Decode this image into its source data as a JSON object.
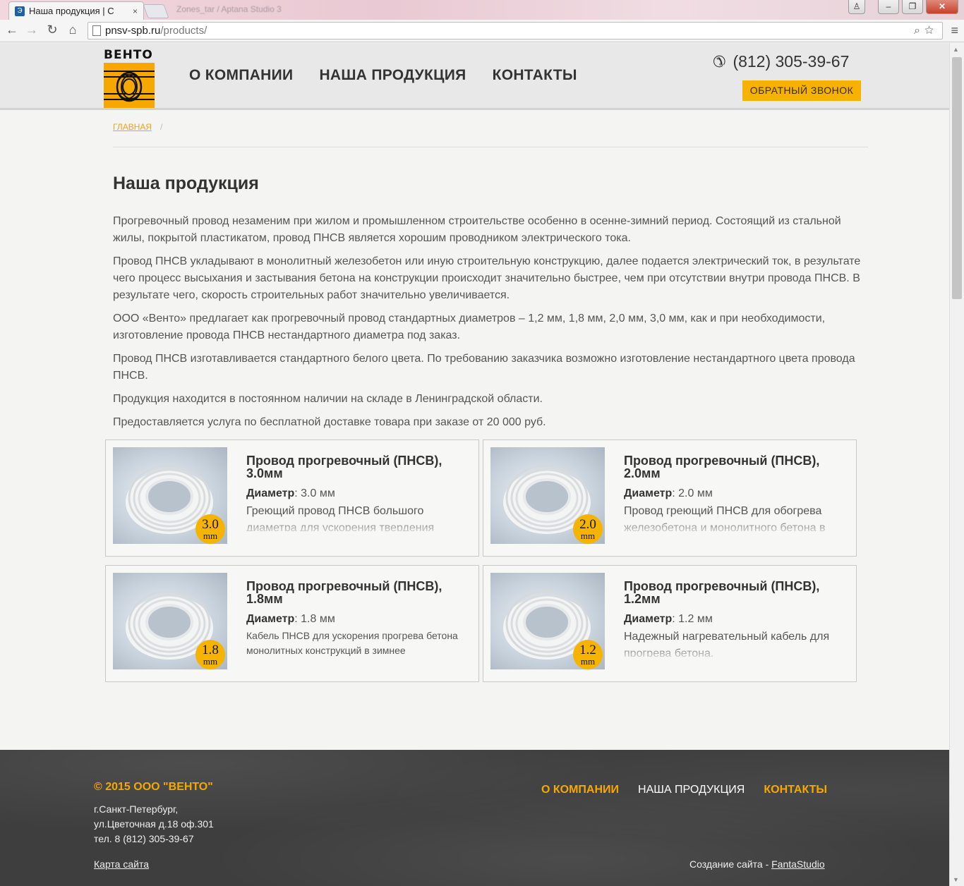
{
  "browser": {
    "tab_title": "Наша продукция | С",
    "tab_close": "×",
    "tab_favicon": "Э",
    "faded_tab_text": "Zones_tar / Aptana Studio 3",
    "url_domain": "pnsv-spb.ru",
    "url_path": "/products/",
    "window_buttons": {
      "user": "♙",
      "minimize": "–",
      "maximize": "❐",
      "close": "✕"
    }
  },
  "header": {
    "logo_text": "ВЕНТО",
    "nav": [
      "О КОМПАНИИ",
      "НАША ПРОДУКЦИЯ",
      "КОНТАКТЫ"
    ],
    "phone": "(812) 305-39-67",
    "callback_label": "ОБРАТНЫЙ ЗВОНОК"
  },
  "breadcrumb": {
    "home": "ГЛАВНАЯ",
    "separator": "/"
  },
  "page": {
    "title": "Наша продукция",
    "paragraphs": [
      "Прогревочный провод незаменим при жилом и промышленном строительстве особенно в осенне-зимний период. Состоящий из стальной жилы, покрытой пластикатом, провод ПНСВ является хорошим проводником электрического тока.",
      "Провод ПНСВ укладывают в монолитный железобетон или иную строительную конструкцию, далее подается электрический ток, в результате чего процесс высыхания и застывания бетона на конструкции происходит значительно быстрее, чем при отсутствии внутри провода ПНСВ. В результате чего, скорость строительных работ значительно увеличивается.",
      "ООО «Венто» предлагает как прогревочный провод стандартных диаметров – 1,2 мм, 1,8 мм, 2,0 мм, 3,0 мм, как и при необходимости, изготовление провода ПНСВ нестандартного диаметра под заказ.",
      "Провод ПНСВ изготавливается стандартного белого цвета. По требованию заказчика возможно изготовление нестандартного цвета провода ПНСВ.",
      "Продукция находится в постоянном наличии на складе в Ленинградской области.",
      "Предоставляется услуга по бесплатной доставке товара при заказе от 20 000 руб."
    ]
  },
  "products": [
    {
      "title": "Провод прогревочный (ПНСВ), 3.0мм",
      "diam_label": "Диаметр",
      "diam_value": ": 3.0 мм",
      "desc": "Греющий провод ПНСВ большого диаметра для ускорения твердения",
      "badge_value": "3.0",
      "badge_unit": "mm"
    },
    {
      "title": "Провод прогревочный (ПНСВ), 2.0мм",
      "diam_label": "Диаметр",
      "diam_value": ": 2.0 мм",
      "desc": "Провод греющий ПНСВ для обогрева железобетона и монолитного бетона в",
      "badge_value": "2.0",
      "badge_unit": "mm"
    },
    {
      "title": "Провод прогревочный (ПНСВ), 1.8мм",
      "diam_label": "Диаметр",
      "diam_value": ": 1.8 мм",
      "desc": "Кабель ПНСВ для ускорения прогрева бетона монолитных конструкций в зимнее",
      "badge_value": "1.8",
      "badge_unit": "mm"
    },
    {
      "title": "Провод прогревочный (ПНСВ), 1.2мм",
      "diam_label": "Диаметр",
      "diam_value": ": 1.2 мм",
      "desc": "Надежный нагревательный кабель для прогрева бетона.",
      "badge_value": "1.2",
      "badge_unit": "mm"
    }
  ],
  "footer": {
    "copyright": "© 2015 ООО \"ВЕНТО\"",
    "address_lines": [
      "г.Санкт-Петербург,",
      "ул.Цветочная д.18 оф.301",
      "тел. 8 (812) 305-39-67"
    ],
    "sitemap": "Карта сайта",
    "nav": [
      "О КОМПАНИИ",
      "НАША ПРОДУКЦИЯ",
      "КОНТАКТЫ"
    ],
    "made_by_prefix": "Создание сайта - ",
    "made_by_link": "FantaStudio"
  },
  "colors": {
    "accent": "#f6a800",
    "nav_text": "#333333",
    "footer_bg": "#3e3e3e",
    "footer_active_link": "#ffffff"
  }
}
